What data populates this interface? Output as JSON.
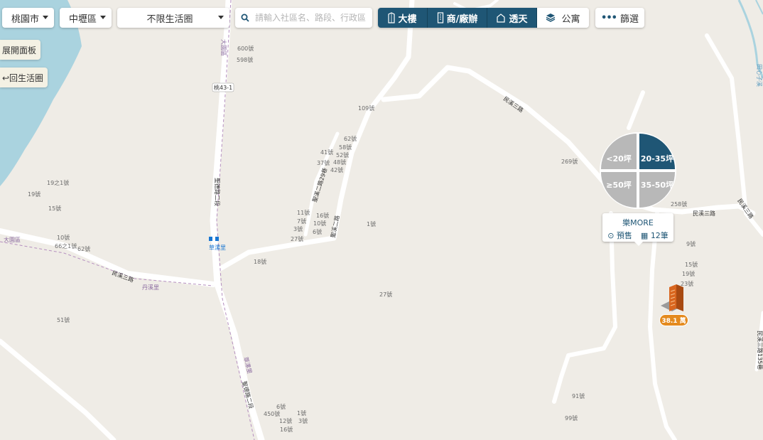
{
  "toolbar": {
    "city": "桃園市",
    "district": "中壢區",
    "life_circle": "不限生活圈",
    "search_placeholder": "請輸入社區名、路段、行政區",
    "property_types": [
      {
        "label": "大樓",
        "active": true,
        "icon": "building-icon"
      },
      {
        "label": "商/廠辦",
        "active": true,
        "icon": "office-icon"
      },
      {
        "label": "透天",
        "active": true,
        "icon": "house-icon"
      },
      {
        "label": "公寓",
        "active": false,
        "icon": "apartment-icon"
      }
    ],
    "filter_label": "篩選",
    "active_color": "#1f5675"
  },
  "side": {
    "expand_panel": "展開面板",
    "back_to_circle": "↩回生活圈"
  },
  "cluster": {
    "segments": [
      "<20坪",
      "20-35坪",
      "≥50坪",
      "35-50坪"
    ],
    "highlight": "20-35坪",
    "name": "樂MORE",
    "presale": "預售",
    "count": "12筆"
  },
  "marker": {
    "price": "38.1 萬",
    "icon": "building-marker-icon"
  },
  "map_labels": {
    "roads": {
      "r1": "桃43-1",
      "r2": "聖德路二段",
      "r3": "聖德路二段",
      "r4": "民溪三路",
      "r5": "聖溪二路",
      "r6": "聖溪二路29巷",
      "r7": "民溪三路",
      "r8": "民溪三路",
      "r9": "民溪三路",
      "r10": "民溪三路135巷"
    },
    "places": {
      "p1": "大園區",
      "p2": "大園區",
      "p3": "草漯里",
      "p4": "丹溪里",
      "p5": "草漯里",
      "p6": "田心子溪"
    },
    "numbers": {
      "n1": "600號",
      "n2": "598號",
      "n3": "109號",
      "n4": "62號",
      "n5": "58號",
      "n6": "41號",
      "n7": "52號",
      "n8": "37號",
      "n9": "48號",
      "n10": "42號",
      "n11": "19之1號",
      "n12": "19號",
      "n13": "15號",
      "n14": "11號",
      "n15": "16號",
      "n16": "7號",
      "n17": "10號",
      "n18": "3號",
      "n19": "6號",
      "n20": "27號",
      "n21": "1號",
      "n22": "10號",
      "n23": "66之1號",
      "n24": "62號",
      "n25": "18號",
      "n26": "27號",
      "n27": "51號",
      "n28": "269號",
      "n29": "258號",
      "n30": "9號",
      "n31": "15號",
      "n32": "19號",
      "n33": "23號",
      "n34": "91號",
      "n35": "99號",
      "n36": "6號",
      "n37": "1號",
      "n38": "450號",
      "n39": "12號",
      "n40": "3號",
      "n41": "16號"
    }
  }
}
